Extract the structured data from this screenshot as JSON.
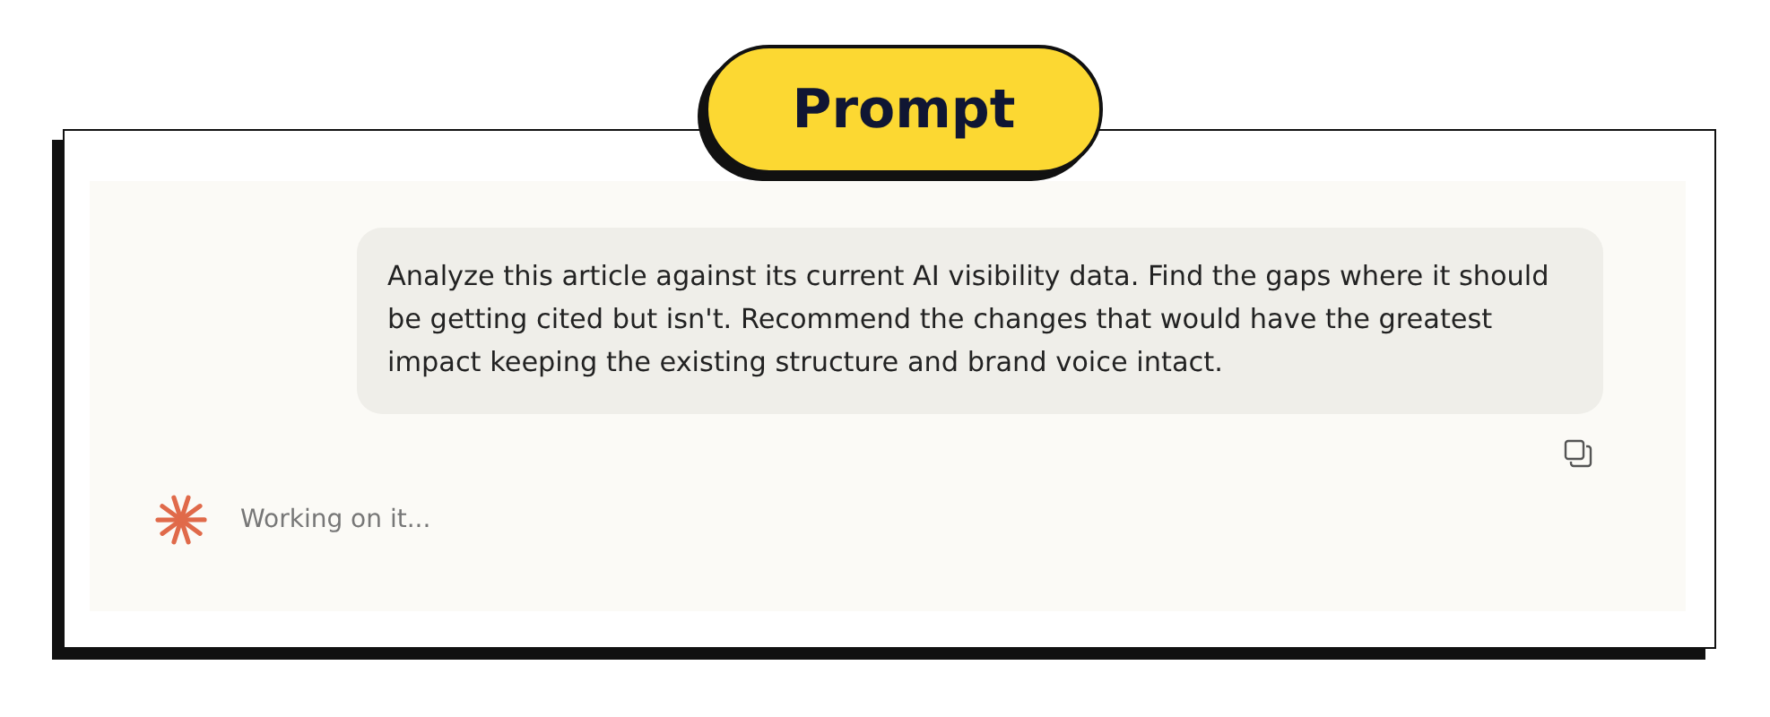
{
  "badge": {
    "label": "Prompt"
  },
  "chat": {
    "user_message": "Analyze this article against its current AI visibility data. Find the gaps where it should be getting cited but isn't. Recommend the changes that would have the greatest impact keeping the existing structure and brand voice intact.",
    "status": "Working on it..."
  }
}
